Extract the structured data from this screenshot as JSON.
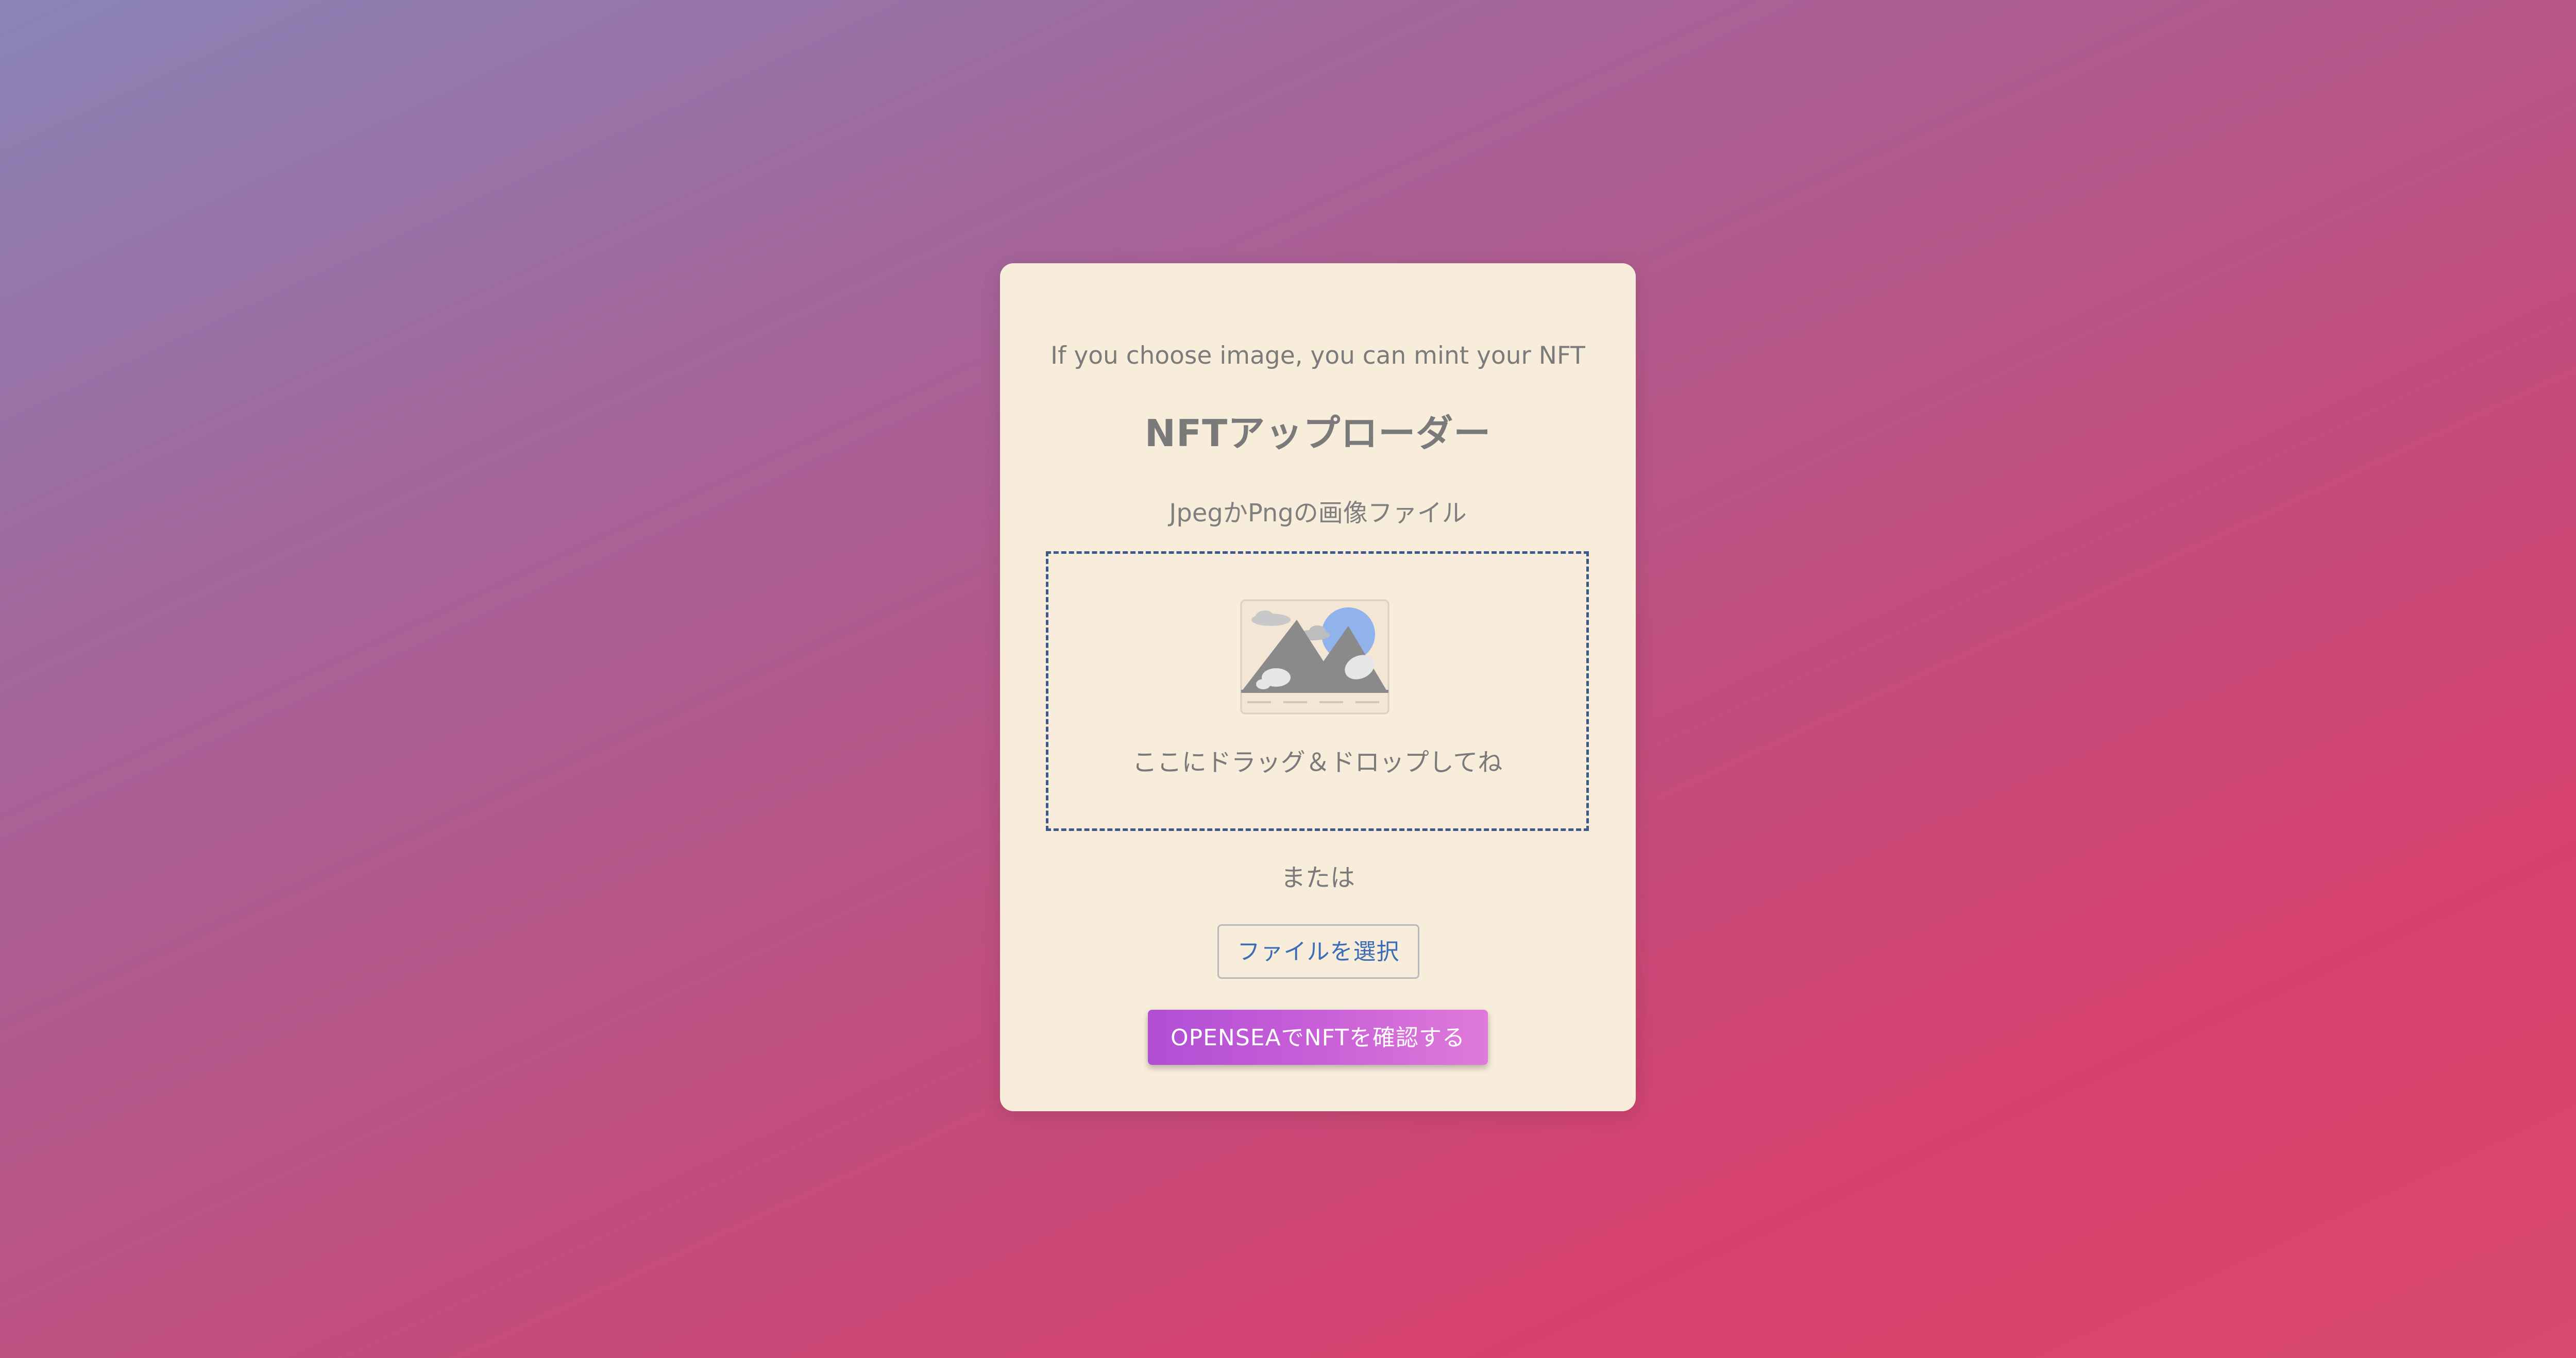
{
  "card": {
    "subtitle": "If you choose image, you can mint your NFT",
    "title": "NFTアップローダー",
    "file_hint": "JpegかPngの画像ファイル",
    "dropzone_text": "ここにドラッグ＆ドロップしてね",
    "or_text": "または",
    "file_button_label": "ファイルを選択",
    "opensea_button_label": "OPENSEAでNFTを確認する"
  },
  "colors": {
    "dropzone_border": "#3b5a8a",
    "file_button_text": "#3a6db5",
    "opensea_gradient_start": "#b04ed4",
    "opensea_gradient_end": "#e07ad9",
    "card_background": "#f8ecdb"
  },
  "icons": {
    "dropzone_illustration": "landscape-image-icon"
  }
}
